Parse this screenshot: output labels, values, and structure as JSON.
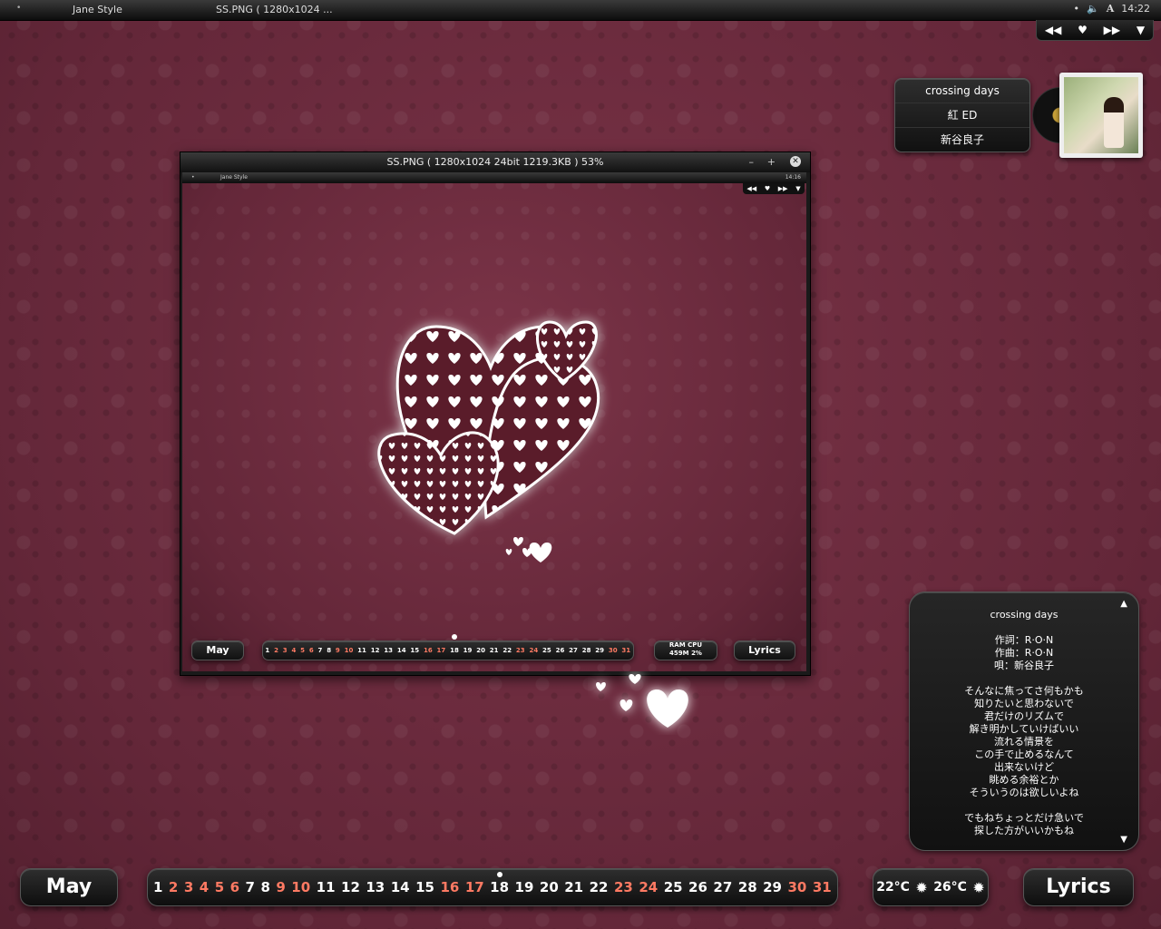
{
  "taskbar": {
    "app": "Jane Style",
    "window": "SS.PNG ( 1280x1024 ...",
    "time": "14:22",
    "tray_icons": [
      "menu-dot-icon",
      "speaker-icon",
      "font-icon"
    ]
  },
  "media_controls": [
    "previous-icon",
    "favorite-heart-icon",
    "next-icon",
    "menu-triangle-icon"
  ],
  "now_playing": {
    "title": "crossing days",
    "album": "紅 ED",
    "artist": "新谷良子"
  },
  "viewer": {
    "title": "SS.PNG ( 1280x1024  24bit  1219.3KB ) 53%",
    "mini_app": "Jane Style",
    "mini_time": "14:16",
    "mini_month": "May",
    "mini_ram_label": "RAM",
    "mini_ram_value": "459M",
    "mini_cpu_label": "CPU",
    "mini_cpu_value": "2%",
    "mini_lyrics": "Lyrics"
  },
  "lyrics": {
    "title": "crossing days",
    "credits": [
      "作詞：R·O·N",
      "作曲：R·O·N",
      "唄：新谷良子"
    ],
    "lines1": [
      "そんなに焦ってさ何もかも",
      "知りたいと思わないで",
      "君だけのリズムで",
      "解き明かしていけばいい",
      "流れる情景を",
      "この手で止めるなんて",
      "出来ないけど",
      "眺める余裕とか",
      "そういうのは欲しいよね"
    ],
    "lines2": [
      "でもねちょっとだけ急いで",
      "探した方がいいかもね"
    ]
  },
  "calendar": {
    "month": "May",
    "days": [
      "1",
      "2",
      "3",
      "4",
      "5",
      "6",
      "7",
      "8",
      "9",
      "10",
      "11",
      "12",
      "13",
      "14",
      "15",
      "16",
      "17",
      "18",
      "19",
      "20",
      "21",
      "22",
      "23",
      "24",
      "25",
      "26",
      "27",
      "28",
      "29",
      "30",
      "31"
    ],
    "weekend_days": [
      "2",
      "3",
      "4",
      "5",
      "6",
      "9",
      "10",
      "16",
      "17",
      "23",
      "24",
      "30",
      "31"
    ],
    "today": "18"
  },
  "weather": {
    "temp1": "22°C",
    "temp2": "26°C"
  },
  "lyrics_button": "Lyrics"
}
